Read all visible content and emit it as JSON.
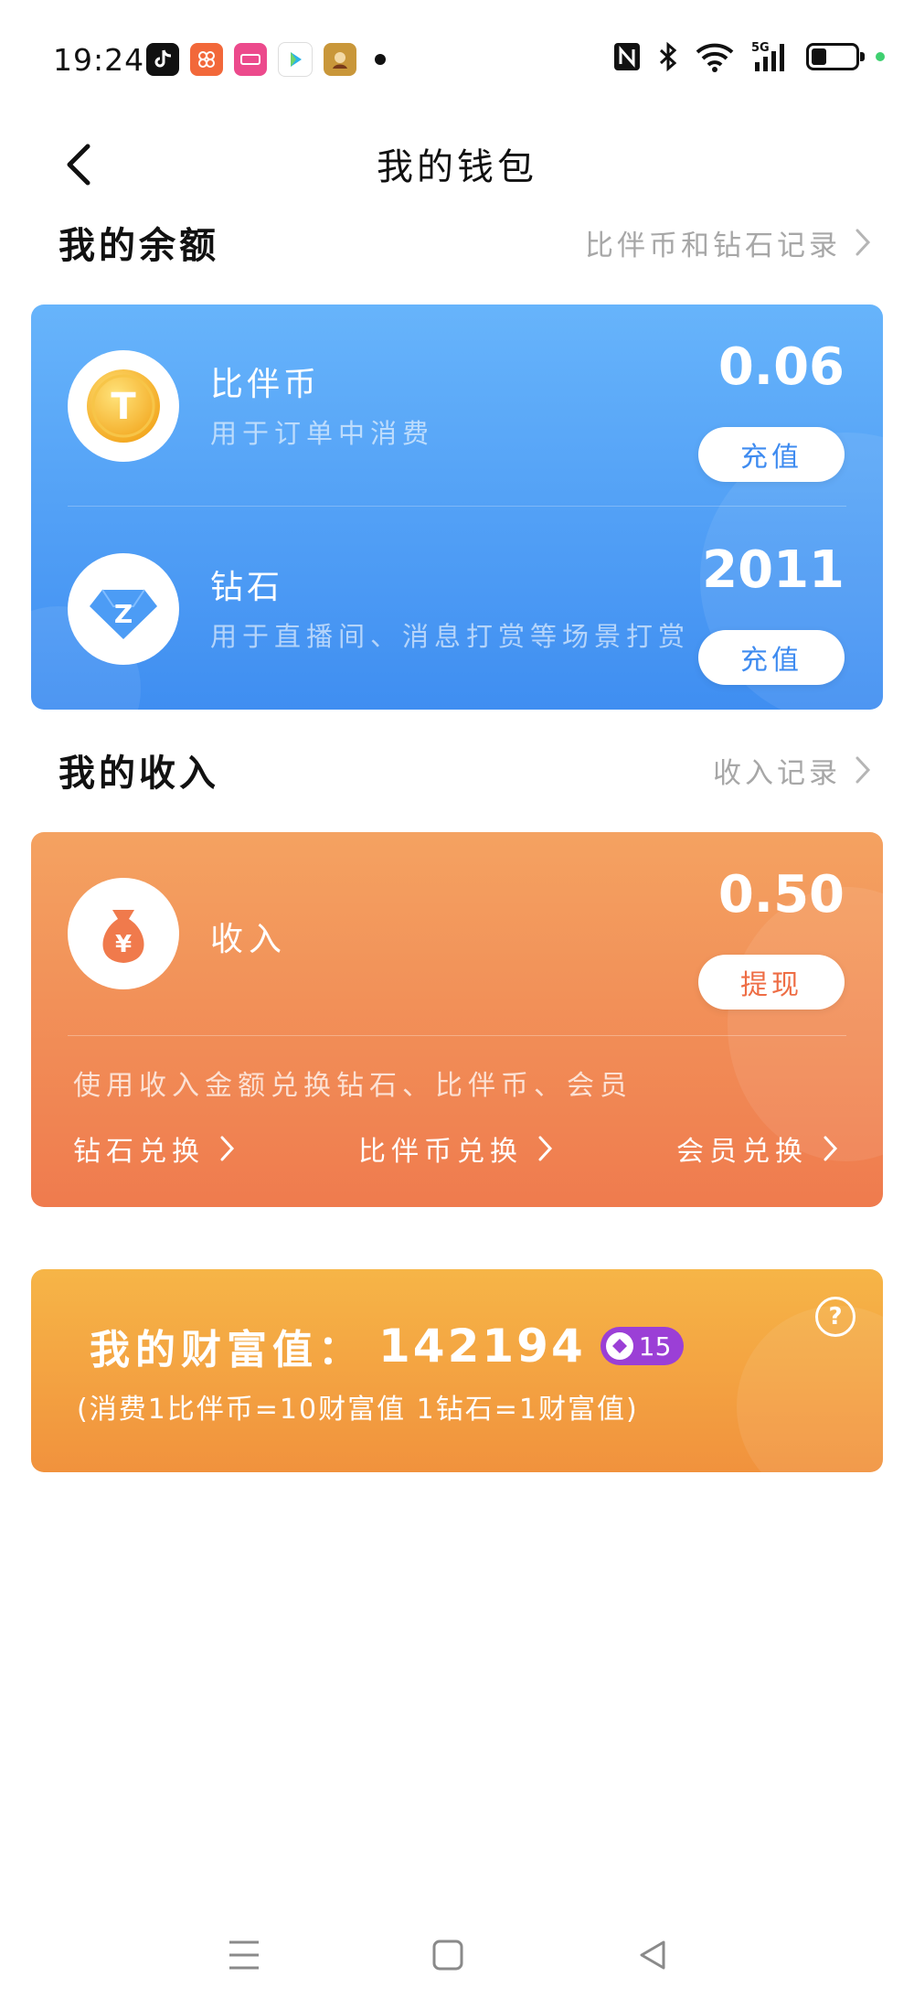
{
  "status_bar": {
    "time": "19:24",
    "notification_icons": [
      "tiktok-icon",
      "app-icon",
      "app-icon",
      "app-icon",
      "game-icon"
    ],
    "network": "5G"
  },
  "header": {
    "title": "我的钱包"
  },
  "balance_section": {
    "title": "我的余额",
    "link_label": "比伴币和钻石记录"
  },
  "balance_card": {
    "coin": {
      "name": "比伴币",
      "description": "用于订单中消费",
      "value": "0.06",
      "button_label": "充值",
      "icon_letter": "T"
    },
    "diamond": {
      "name": "钻石",
      "description": "用于直播间、消息打赏等场景打赏",
      "value": "2011",
      "button_label": "充值",
      "icon_letter": "Z"
    }
  },
  "income_section": {
    "title": "我的收入",
    "link_label": "收入记录"
  },
  "income_card": {
    "name": "收入",
    "value": "0.50",
    "button_label": "提现",
    "icon_symbol": "¥",
    "hint": "使用收入金额兑换钻石、比伴币、会员",
    "exchanges": [
      {
        "label": "钻石兑换"
      },
      {
        "label": "比伴币兑换"
      },
      {
        "label": "会员兑换"
      }
    ]
  },
  "wealth_card": {
    "label": "我的财富值：",
    "value": "142194",
    "level": "15",
    "note": "(消费1比伴币=10财富值  1钻石=1财富值)",
    "help_symbol": "?"
  },
  "colors": {
    "balance_card_top": "#67b4fb",
    "balance_card_bottom": "#3f8ef1",
    "income_card_top": "#f4a261",
    "income_card_bottom": "#ef7b4e",
    "wealth_card_top": "#f6b547",
    "wealth_card_bottom": "#f1923d",
    "level_badge": "#9b3fd6"
  }
}
